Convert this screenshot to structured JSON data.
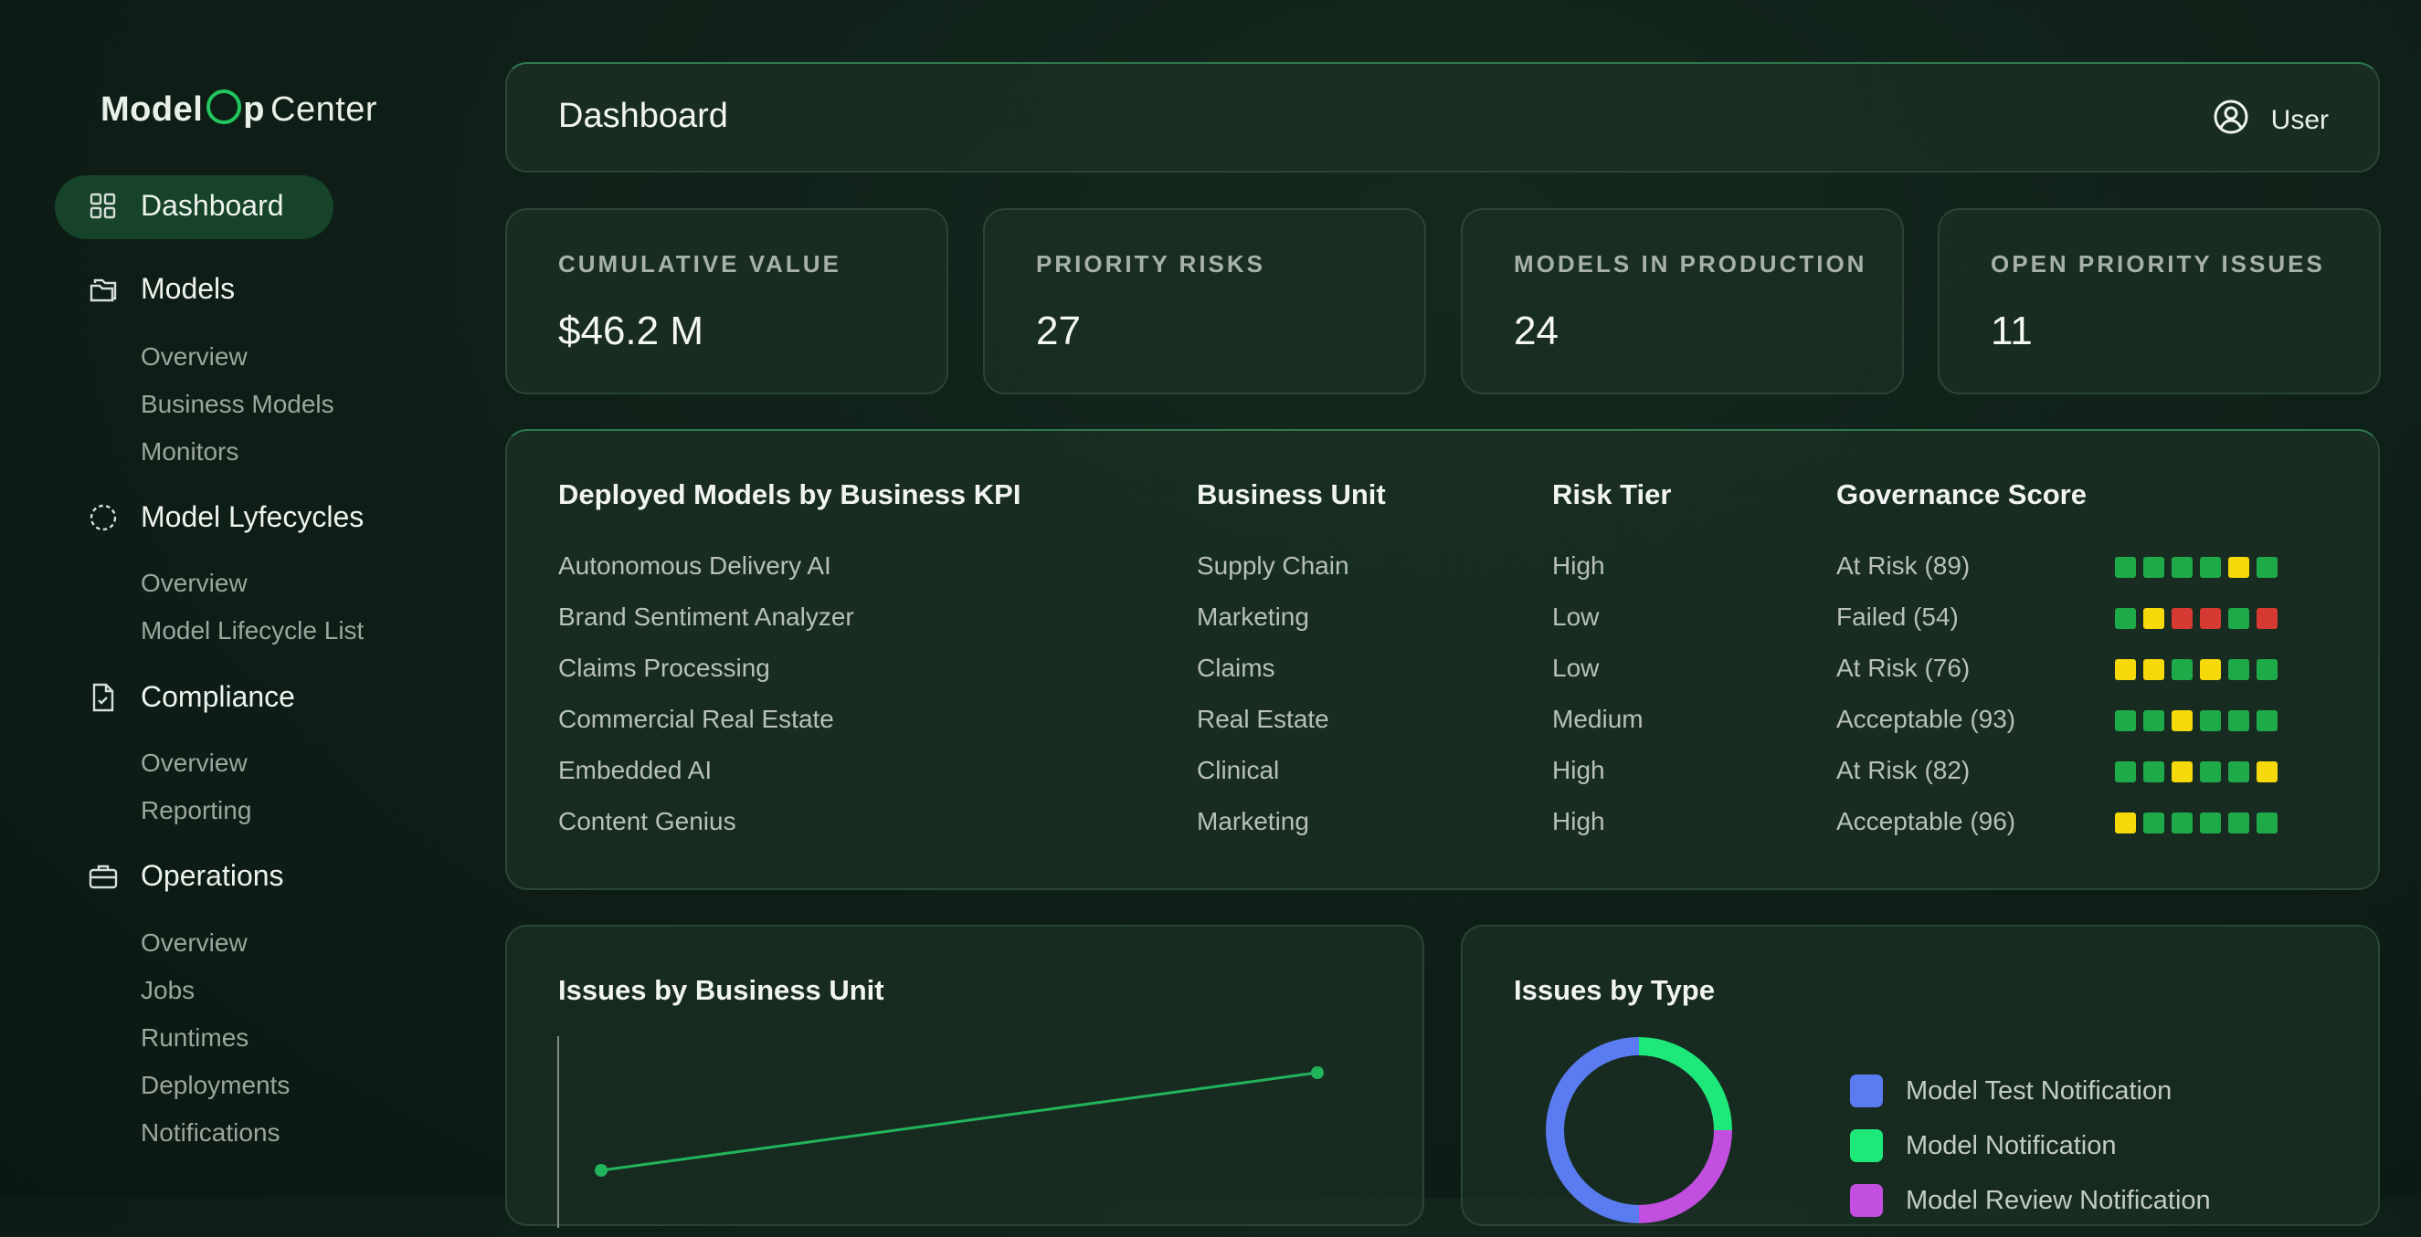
{
  "app": {
    "logo_part1": "Model",
    "logo_part2": "p",
    "logo_part3": "Center"
  },
  "sidebar": {
    "items": [
      {
        "label": "Dashboard",
        "icon": "grid-icon",
        "active": true,
        "subitems": []
      },
      {
        "label": "Models",
        "icon": "folders-icon",
        "subitems": [
          "Overview",
          "Business Models",
          "Monitors"
        ]
      },
      {
        "label": "Model Lyfecycles",
        "icon": "dashed-circle-icon",
        "subitems": [
          "Overview",
          "Model Lifecycle List"
        ]
      },
      {
        "label": "Compliance",
        "icon": "document-check-icon",
        "subitems": [
          "Overview",
          "Reporting"
        ]
      },
      {
        "label": "Operations",
        "icon": "briefcase-icon",
        "subitems": [
          "Overview",
          "Jobs",
          "Runtimes",
          "Deployments",
          "Notifications"
        ]
      }
    ]
  },
  "header": {
    "title": "Dashboard",
    "user_label": "User",
    "user_icon": "user-circle-icon"
  },
  "stats": [
    {
      "label": "CUMULATIVE VALUE",
      "value": "$46.2 M"
    },
    {
      "label": "PRIORITY RISKS",
      "value": "27"
    },
    {
      "label": "MODELS IN PRODUCTION",
      "value": "24"
    },
    {
      "label": "OPEN PRIORITY ISSUES",
      "value": "11"
    }
  ],
  "models_table": {
    "headers": [
      "Deployed Models by Business KPI",
      "Business Unit",
      "Risk Tier",
      "Governance Score"
    ],
    "rows": [
      {
        "model": "Autonomous Delivery AI",
        "unit": "Supply Chain",
        "risk": "High",
        "score": "At Risk (89)",
        "blocks": [
          "g",
          "g",
          "g",
          "g",
          "y",
          "g"
        ]
      },
      {
        "model": "Brand Sentiment Analyzer",
        "unit": "Marketing",
        "risk": "Low",
        "score": "Failed (54)",
        "blocks": [
          "g",
          "y",
          "r",
          "r",
          "g",
          "r"
        ]
      },
      {
        "model": "Claims Processing",
        "unit": "Claims",
        "risk": "Low",
        "score": "At Risk (76)",
        "blocks": [
          "y",
          "y",
          "g",
          "y",
          "g",
          "g"
        ]
      },
      {
        "model": "Commercial Real Estate",
        "unit": "Real Estate",
        "risk": "Medium",
        "score": "Acceptable (93)",
        "blocks": [
          "g",
          "g",
          "y",
          "g",
          "g",
          "g"
        ]
      },
      {
        "model": "Embedded AI",
        "unit": "Clinical",
        "risk": "High",
        "score": "At Risk (82)",
        "blocks": [
          "g",
          "g",
          "y",
          "g",
          "g",
          "y"
        ]
      },
      {
        "model": "Content Genius",
        "unit": "Marketing",
        "risk": "High",
        "score": "Acceptable (96)",
        "blocks": [
          "y",
          "g",
          "g",
          "g",
          "g",
          "g"
        ]
      }
    ]
  },
  "block_colors": {
    "g": "#1faa4a",
    "y": "#f5d90a",
    "r": "#d63a32"
  },
  "issues_by_unit": {
    "title": "Issues by Business Unit",
    "line_color": "#22b45a"
  },
  "issues_by_type": {
    "title": "Issues by Type",
    "legend": [
      {
        "label": "Model Test Notification",
        "color": "#5b7cf0"
      },
      {
        "label": "Model Notification",
        "color": "#1ee87a"
      },
      {
        "label": "Model Review Notification",
        "color": "#c24fe0"
      }
    ]
  }
}
